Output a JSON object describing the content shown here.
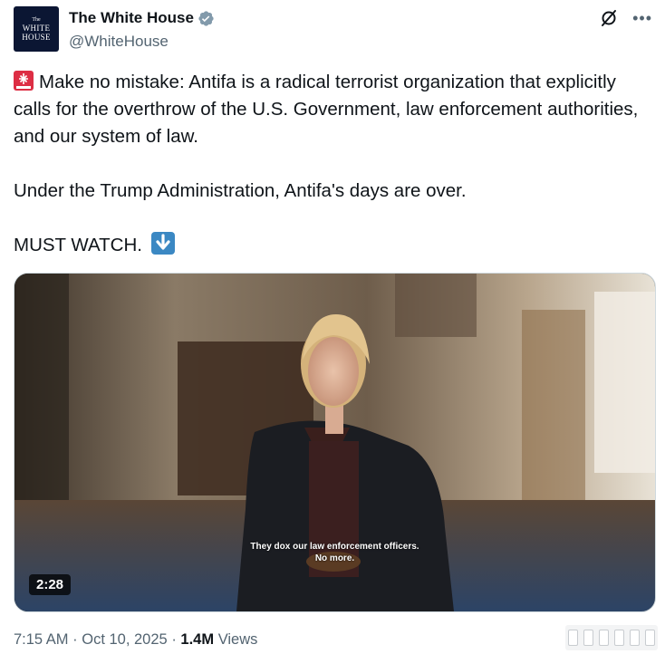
{
  "author": {
    "name": "The White House",
    "handle": "@WhiteHouse",
    "avatar_lines": [
      "The",
      "WHITE",
      "HOUSE"
    ]
  },
  "icons": {
    "verified": "verified-badge-icon",
    "grok": "grok-icon",
    "more": "more-icon"
  },
  "tweet": {
    "line1": "Make no mistake: Antifa is a radical terrorist organization that explicitly calls for the overthrow of the U.S. Government, law enforcement authorities, and our system of law.",
    "line2": "Under the Trump Administration, Antifa's days are over.",
    "line3": "MUST WATCH."
  },
  "video": {
    "subtitle_line1": "They dox our law enforcement officers.",
    "subtitle_line2": "No more.",
    "duration": "2:28"
  },
  "meta": {
    "time": "7:15 AM",
    "sep1": "·",
    "date": "Oct 10, 2025",
    "sep2": "·",
    "views_count": "1.4M",
    "views_label": "Views"
  },
  "colors": {
    "verified": "#1d9bf0",
    "text": "#0f1419",
    "muted": "#536471"
  }
}
